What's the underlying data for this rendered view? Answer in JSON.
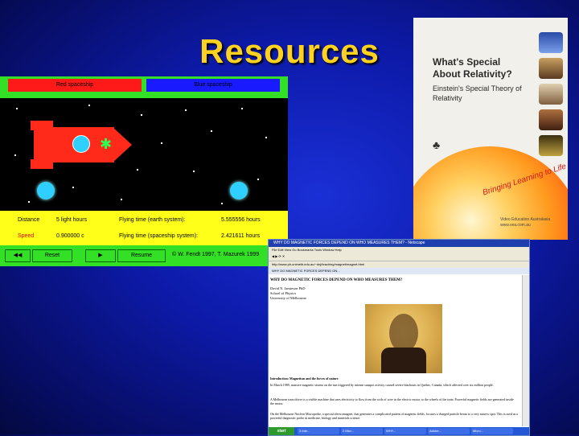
{
  "slide": {
    "title": "Resources"
  },
  "simulation": {
    "top_buttons": [
      "Red spaceship",
      "Blue spaceship"
    ],
    "info": {
      "distance_label": "Distance",
      "distance_value": "5 light hours",
      "flying_time_earth_label": "Flying time (earth system):",
      "flying_time_earth_value": "5.555556 hours",
      "speed_label": "Speed",
      "speed_value": "0.900000 c",
      "flying_time_ship_label": "Flying time (spaceship system):",
      "flying_time_ship_value": "2.421611 hours"
    },
    "controls": {
      "rewind_label": "◀◀",
      "reset_label": "Reset",
      "play_label": "▶",
      "resume_label": "Resume",
      "copyright": "© W. Fendt 1997, T. Mazurek 1999"
    }
  },
  "book": {
    "title": "What's Special About Relativity?",
    "subtitle": "Einstein's Special Theory of Relativity",
    "tagline": "Bringing Learning to Life",
    "publisher": "Video Education Australasia",
    "url": "www.vea.com.au"
  },
  "browser": {
    "window_title": "WHY DO MAGNETIC FORCES DEPEND ON WHO MEASURES THEM? - Netscape",
    "menu": "File  Edit  View  Go  Bookmarks  Tools  Window  Help",
    "address": "http://www.ph.unimelb.edu.au/~dnj/teaching/magnet/magnet.html",
    "tab": "WHY DO MAGNETIC FORCES DEPEND ON...",
    "heading": "WHY DO MAGNETIC FORCES DEPEND ON WHO MEASURES THEM?",
    "author": [
      "David N. Jamieson PhD",
      "School of Physics",
      "University of Melbourne"
    ],
    "section_heading": "Introduction: Magnetism and the forces of nature",
    "paragraphs": [
      "In March 1989, massive magnetic storms on the sun triggered by intense sunspot activity caused severe blackouts in Quebec, Canada, which affected over six million people.",
      "A Melbourne tram driver is a visible machine that uses electricity to flow from the coils of wire in the electric motor, to the wheels of the train. Powerful magnetic fields are generated inside the motor.",
      "On the Melbourne Nuclear Microprobe, a special electromagnet, that generates a complicated pattern of magnetic fields, focuses a charged particle beam to a very narrow spot. This is used as a powerful diagnostic probe in medicine, biology and materials science."
    ],
    "taskbar": {
      "start": "start",
      "tasks": [
        "3 Inte...",
        "2 Micr...",
        "WHY...",
        "Adobe...",
        "Micro..."
      ]
    }
  }
}
